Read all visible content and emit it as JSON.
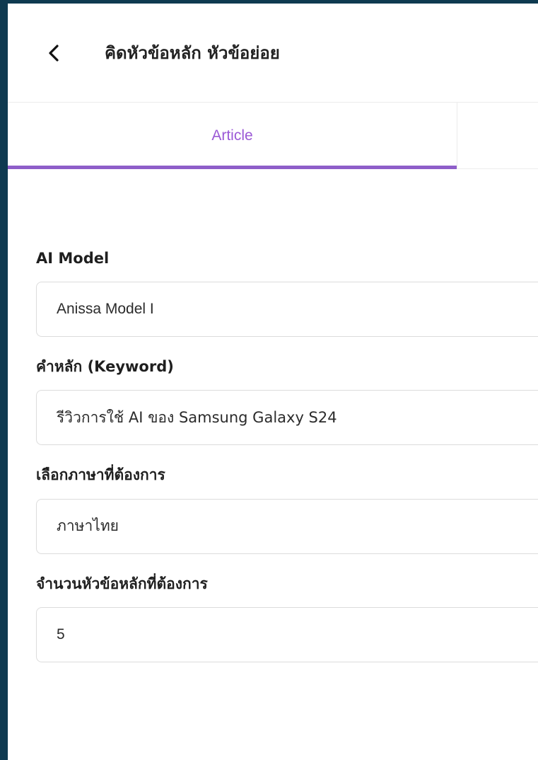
{
  "header": {
    "title": "คิดหัวข้อหลัก หัวข้อย่อย",
    "back_icon": "chevron-left-icon"
  },
  "tabs": [
    {
      "label": "Article",
      "active": true
    },
    {
      "label": "",
      "active": false
    }
  ],
  "form": {
    "ai_model": {
      "label": "AI Model",
      "value": "Anissa Model I"
    },
    "keyword": {
      "label": "คำหลัก (Keyword)",
      "value": "รีวิวการใช้ AI ของ Samsung Galaxy S24"
    },
    "language": {
      "label": "เลือกภาษาที่ต้องการ",
      "value": "ภาษาไทย"
    },
    "headings_count": {
      "label": "จำนวนหัวข้อหลักที่ต้องการ",
      "value": "5"
    }
  },
  "colors": {
    "accent": "#8e5ec9",
    "active_tab_text": "#9b59d6",
    "background": "#0f3a50"
  }
}
